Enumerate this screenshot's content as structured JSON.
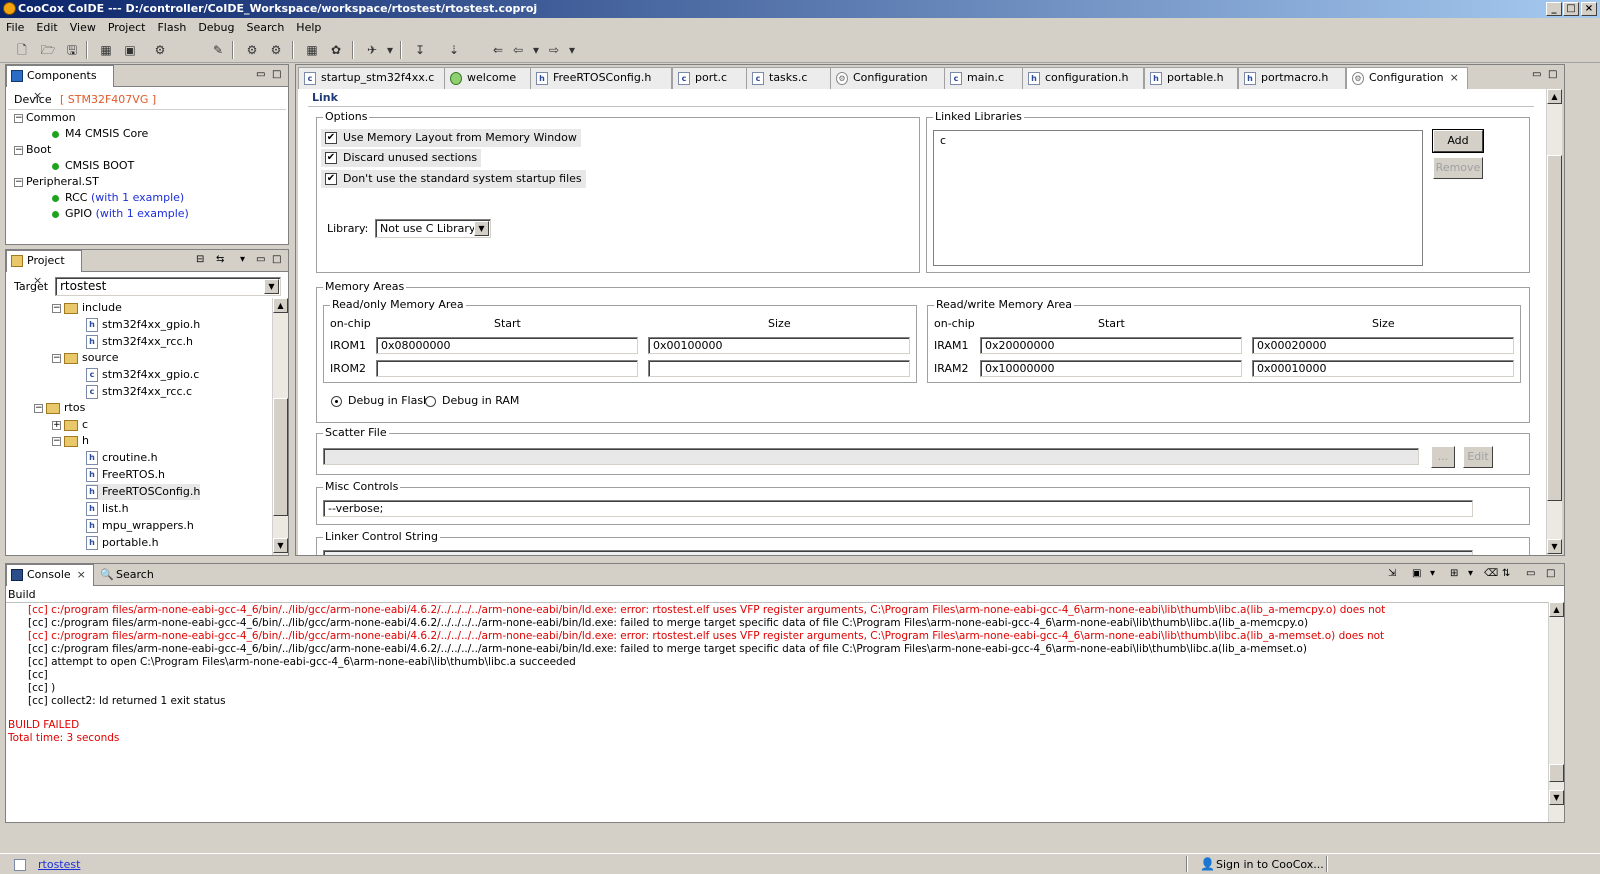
{
  "window": {
    "title": "CooCox CoIDE --- D:/controller/CoIDE_Workspace/workspace/rtostest/rtostest.coproj"
  },
  "menu": [
    "File",
    "Edit",
    "View",
    "Project",
    "Flash",
    "Debug",
    "Search",
    "Help"
  ],
  "components": {
    "tab_label": "Components",
    "device_label": "Device",
    "device_value": "[ STM32F407VG ]",
    "tree": [
      {
        "label": "Common"
      },
      {
        "label": "M4 CMSIS Core"
      },
      {
        "label": "Boot"
      },
      {
        "label": "CMSIS BOOT"
      },
      {
        "label": "Peripheral.ST"
      },
      {
        "label": "RCC",
        "extra": "(with 1 example)"
      },
      {
        "label": "GPIO",
        "extra": "(with 1 example)"
      }
    ]
  },
  "project": {
    "tab_label": "Project",
    "target_label": "Target",
    "target_value": "rtostest",
    "tree": [
      {
        "label": "include"
      },
      {
        "label": "stm32f4xx_gpio.h"
      },
      {
        "label": "stm32f4xx_rcc.h"
      },
      {
        "label": "source"
      },
      {
        "label": "stm32f4xx_gpio.c"
      },
      {
        "label": "stm32f4xx_rcc.c"
      },
      {
        "label": "rtos"
      },
      {
        "label": "c"
      },
      {
        "label": "h"
      },
      {
        "label": "croutine.h"
      },
      {
        "label": "FreeRTOS.h"
      },
      {
        "label": "FreeRTOSConfig.h"
      },
      {
        "label": "list.h"
      },
      {
        "label": "mpu_wrappers.h"
      },
      {
        "label": "portable.h"
      }
    ]
  },
  "editor_tabs": [
    {
      "label": "startup_stm32f4xx.c",
      "icon": "c"
    },
    {
      "label": "welcome",
      "icon": "w"
    },
    {
      "label": "FreeRTOSConfig.h",
      "icon": "h"
    },
    {
      "label": "port.c",
      "icon": "c"
    },
    {
      "label": "tasks.c",
      "icon": "c"
    },
    {
      "label": "Configuration",
      "icon": "gear"
    },
    {
      "label": "main.c",
      "icon": "c"
    },
    {
      "label": "configuration.h",
      "icon": "h"
    },
    {
      "label": "portable.h",
      "icon": "h"
    },
    {
      "label": "portmacro.h",
      "icon": "h"
    },
    {
      "label": "Configuration",
      "icon": "gear"
    }
  ],
  "link": {
    "section_title": "Link",
    "options_title": "Options",
    "options": [
      {
        "label": "Use Memory Layout from Memory Window",
        "checked": true
      },
      {
        "label": "Discard unused sections",
        "checked": true
      },
      {
        "label": "Don't use the standard system startup files",
        "checked": true
      }
    ],
    "library_label": "Library:",
    "library_value": "Not use C Library",
    "linked_libraries_title": "Linked Libraries",
    "linked_libraries": [
      "c"
    ],
    "add_label": "Add",
    "remove_label": "Remove",
    "memory_areas_title": "Memory Areas",
    "ro_title": "Read/only Memory Area",
    "rw_title": "Read/write Memory Area",
    "on_chip": "on-chip",
    "start": "Start",
    "size": "Size",
    "ro_rows": [
      {
        "name": "IROM1",
        "start": "0x08000000",
        "size": "0x00100000"
      },
      {
        "name": "IROM2",
        "start": "",
        "size": ""
      }
    ],
    "rw_rows": [
      {
        "name": "IRAM1",
        "start": "0x20000000",
        "size": "0x00020000"
      },
      {
        "name": "IRAM2",
        "start": "0x10000000",
        "size": "0x00010000"
      }
    ],
    "debug_flash": "Debug in Flash",
    "debug_ram": "Debug in RAM",
    "scatter_title": "Scatter File",
    "browse_label": "...",
    "edit_label": "Edit",
    "misc_title": "Misc Controls",
    "misc_value": "--verbose;",
    "linker_string_title": "Linker Control String"
  },
  "console": {
    "tab_label": "Console",
    "search_tab": "Search",
    "header": "Build",
    "lines": [
      {
        "text": "[cc] c:/program files/arm-none-eabi-gcc-4_6/bin/../lib/gcc/arm-none-eabi/4.6.2/../../../../arm-none-eabi/bin/ld.exe: error: rtostest.elf uses VFP register arguments, C:\\Program Files\\arm-none-eabi-gcc-4_6\\arm-none-eabi\\lib\\thumb\\libc.a(lib_a-memcpy.o) does not",
        "error": true
      },
      {
        "text": "[cc] c:/program files/arm-none-eabi-gcc-4_6/bin/../lib/gcc/arm-none-eabi/4.6.2/../../../../arm-none-eabi/bin/ld.exe: failed to merge target specific data of file C:\\Program Files\\arm-none-eabi-gcc-4_6\\arm-none-eabi\\lib\\thumb\\libc.a(lib_a-memcpy.o)",
        "error": false
      },
      {
        "text": "[cc] c:/program files/arm-none-eabi-gcc-4_6/bin/../lib/gcc/arm-none-eabi/4.6.2/../../../../arm-none-eabi/bin/ld.exe: error: rtostest.elf uses VFP register arguments, C:\\Program Files\\arm-none-eabi-gcc-4_6\\arm-none-eabi\\lib\\thumb\\libc.a(lib_a-memset.o) does not",
        "error": true
      },
      {
        "text": "[cc] c:/program files/arm-none-eabi-gcc-4_6/bin/../lib/gcc/arm-none-eabi/4.6.2/../../../../arm-none-eabi/bin/ld.exe: failed to merge target specific data of file C:\\Program Files\\arm-none-eabi-gcc-4_6\\arm-none-eabi\\lib\\thumb\\libc.a(lib_a-memset.o)",
        "error": false
      },
      {
        "text": "[cc] attempt to open C:\\Program Files\\arm-none-eabi-gcc-4_6\\arm-none-eabi\\lib\\thumb\\libc.a succeeded",
        "error": false
      },
      {
        "text": "[cc]",
        "error": false
      },
      {
        "text": "[cc] )",
        "error": false
      },
      {
        "text": "[cc] collect2: ld returned 1 exit status",
        "error": false
      }
    ],
    "build_failed": "BUILD FAILED",
    "total_time": "Total time: 3 seconds"
  },
  "status": {
    "project_link": "rtostest",
    "sign_in": "Sign in to CooCox..."
  },
  "colors": {
    "error": "#e00000",
    "link": "#1c2fd8",
    "device": "#e05a2a",
    "title_start": "#0a246a",
    "title_end": "#a6caf0"
  }
}
